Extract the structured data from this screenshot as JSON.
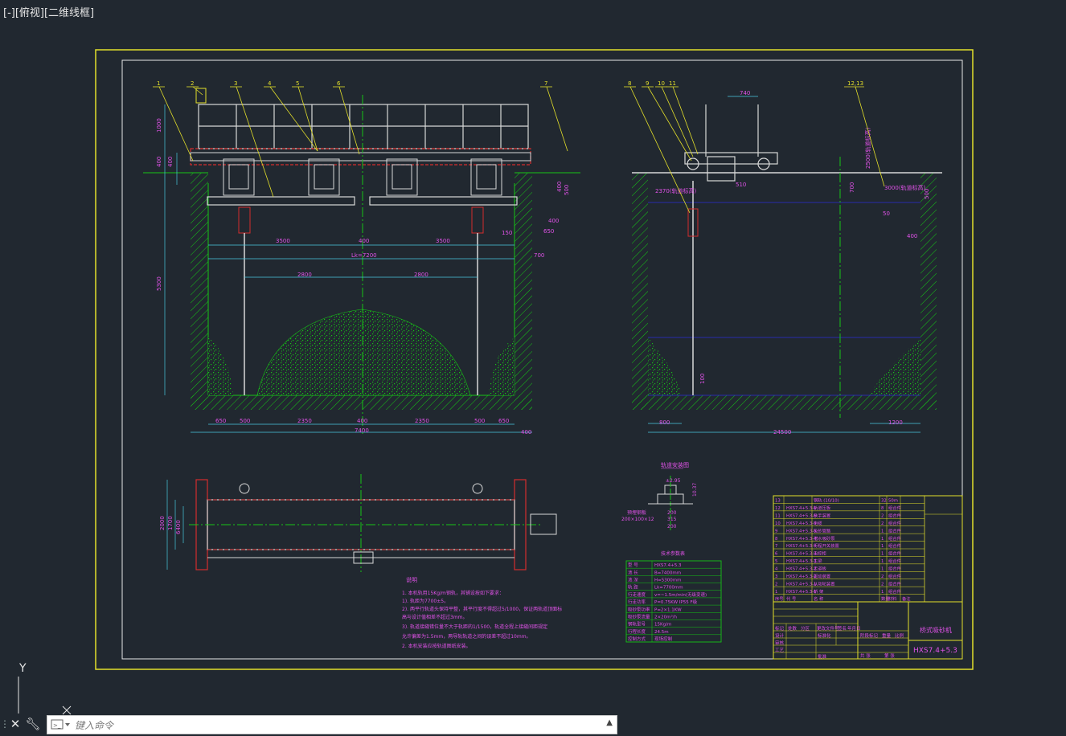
{
  "viewport": {
    "label": "[-][俯视][二维线框]"
  },
  "colors": {
    "background": "#212830",
    "frame": "#e3df2a",
    "magenta": "#e052e8",
    "green": "#16c416",
    "cyan": "#48c9df",
    "white": "#d8d8d8",
    "red": "#d42d2d"
  },
  "balloons": {
    "front": [
      "1",
      "2",
      "3",
      "4",
      "5",
      "6",
      "7"
    ],
    "side": [
      "8",
      "9",
      "10",
      "11",
      "12,13"
    ]
  },
  "dims": {
    "front_bottom": [
      "650",
      "500",
      "2350",
      "400",
      "2350",
      "500",
      "650"
    ],
    "front_total": "7400",
    "front_total_right": "400",
    "front_mid_upper": [
      "3500",
      "400",
      "3500"
    ],
    "front_lk": "Lk=7200",
    "front_mid_lower": [
      "2800",
      "2800"
    ],
    "front_left_vert": [
      "1000",
      "400",
      "400",
      "5300"
    ],
    "front_right": [
      "400",
      "500",
      "400",
      "150",
      "650",
      "700"
    ],
    "side_bottom_left": "800",
    "side_bottom_total": "24500",
    "side_bottom_right": "1200",
    "side_top": "740",
    "side_misc": [
      "2370(轨道标高)",
      "510",
      "700",
      "50",
      "400",
      "500",
      "100",
      "2500(轨道标高)",
      "3000(轨道标高)"
    ],
    "plan_left": [
      "2000",
      "1700",
      "6400"
    ],
    "detail": [
      "±2.95",
      "200",
      "315",
      "10.37",
      "200×100×12"
    ]
  },
  "detail": {
    "title": "轨道安装图",
    "label": "预埋钢板\n200×100×12"
  },
  "notes": {
    "title": "说明",
    "lines": [
      "1. 本机轨用15Kg/m钢轨，其铺设按如下要求：",
      "  1). 轨距为7700±5。",
      "  2). 两平行轨道头保持平整，其平行度不得超过5/1000，保证两轨道顶面标",
      "     高与设计值相差不超过3mm。",
      "  3). 轨道接缝错位量不大于轨距的1/1500，轨道全程上接缝间距规定",
      "     允许偏差为1.5mm，两导轨轨道之间的误差不超过10mm。",
      "2. 本机安装应按轨道图纸安装。"
    ]
  },
  "params": {
    "title": "技术参数表",
    "rows": [
      [
        "型  号",
        "HXS7.4+5.3"
      ],
      [
        "池  长",
        "B=7400mm"
      ],
      [
        "池  深",
        "H=5300mm"
      ],
      [
        "轨  距",
        "Lk=7700mm"
      ],
      [
        "行走速度",
        "v=~1.5m/min(无级变速)"
      ],
      [
        "行走功率",
        "P=0.75KW  IP55 F级"
      ],
      [
        "吸砂泵功率",
        "P=2×1.1KW"
      ],
      [
        "吸砂泵流量",
        "2×20m³/h"
      ],
      [
        "钢轨型号",
        "15Kg/m"
      ],
      [
        "行程长度",
        "24.5m"
      ],
      [
        "控制方式",
        "现场控制"
      ]
    ]
  },
  "bom": {
    "rows": [
      [
        "13",
        "",
        "钢轨  (10/10)",
        "",
        "32",
        "50m",
        ""
      ],
      [
        "12",
        "HXS7.4+5.3-6",
        "轨道压板",
        "",
        "8",
        "组合件",
        ""
      ],
      [
        "11",
        "HXS7.4+5.3-6",
        "扶手装置",
        "",
        "2",
        "组合件",
        ""
      ],
      [
        "10",
        "HXS7.4+5.3-5",
        "电缆",
        "",
        "2",
        "组合件",
        ""
      ],
      [
        "9",
        "HXS7.4+5.3-5",
        "吸砂管路",
        "",
        "1",
        "组合件",
        ""
      ],
      [
        "8",
        "HXS7.4+5.3-4",
        "潜水吸砂泵",
        "",
        "1",
        "组合件",
        ""
      ],
      [
        "7",
        "HXS7.4+5.3-4",
        "行程开关装置",
        "",
        "1",
        "组合件",
        ""
      ],
      [
        "6",
        "HXS7.4+5.3-3",
        "电控柜",
        "",
        "1",
        "组合件",
        ""
      ],
      [
        "5",
        "HXS7.4+5.3-3",
        "主梁",
        "",
        "1",
        "组合件",
        ""
      ],
      [
        "4",
        "HXS7.4+5.3-2",
        "走道板",
        "",
        "1",
        "组合件",
        ""
      ],
      [
        "3",
        "HXS7.4+5.3-2",
        "驱动装置",
        "",
        "2",
        "组合件",
        ""
      ],
      [
        "2",
        "HXS7.4+5.3-1",
        "从动轮装置",
        "",
        "2",
        "组合件",
        ""
      ],
      [
        "1",
        "HXS7.4+5.3-1",
        "桥  架",
        "",
        "1",
        "组合件",
        ""
      ]
    ],
    "header": [
      "序号",
      "代  号",
      "名  称",
      "",
      "数量",
      "材料",
      "备注"
    ],
    "title_text": "桥式吸砂机",
    "drawing_no": "HXS7.4+5.3",
    "labels": [
      "标记",
      "处数",
      "分区",
      "更改文件号",
      "签名",
      "年月日",
      "设计",
      "审核",
      "工艺",
      "标准化",
      "批准",
      "阶段标记",
      "重量",
      "比例",
      "共  张",
      "第  张"
    ]
  },
  "command": {
    "placeholder": "键入命令"
  },
  "ucs": {
    "axis_label": "Y"
  }
}
